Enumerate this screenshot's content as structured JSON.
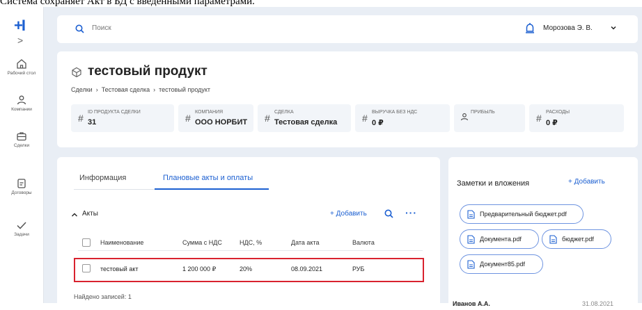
{
  "caption": "Система сохраняет Акт в БД с введенными параметрами.",
  "sidebar": {
    "collapse_glyph": ">",
    "items": [
      {
        "label": "Рабочий стол"
      },
      {
        "label": "Компании"
      },
      {
        "label": "Сделки"
      },
      {
        "label": "Договоры"
      },
      {
        "label": "Задачи"
      }
    ]
  },
  "topbar": {
    "search_placeholder": "Поиск",
    "user_name": "Морозова Э. В."
  },
  "product": {
    "title": "тестовый продукт",
    "breadcrumb": [
      "Сделки",
      "Тестовая сделка",
      "тестовый продукт"
    ]
  },
  "stats": [
    {
      "label": "ID ПРОДУКТА СДЕЛКИ",
      "value": "31"
    },
    {
      "label": "КОМПАНИЯ",
      "value": "ООО НОРБИТ"
    },
    {
      "label": "СДЕЛКА",
      "value": "Тестовая сделка"
    },
    {
      "label": "ВЫРУЧКА БЕЗ НДС",
      "value": "0 ₽"
    },
    {
      "label": "ПРИБЫЛЬ",
      "value": ""
    },
    {
      "label": "РАСХОДЫ",
      "value": "0 ₽"
    }
  ],
  "tabs": {
    "info": "Информация",
    "plan": "Плановые акты и оплаты"
  },
  "acts": {
    "title": "Акты",
    "add_label": "+ Добавить",
    "more_label": "···",
    "columns": [
      "Наименование",
      "Сумма с НДС",
      "НДС, %",
      "Дата акта",
      "Валюта"
    ],
    "rows": [
      [
        "тестовый акт",
        "1 200 000 ₽",
        "20%",
        "08.09.2021",
        "РУБ"
      ]
    ],
    "records": "Найдено записей: 1"
  },
  "notes": {
    "title": "Заметки и вложения",
    "add_label": "+ Добавить",
    "files": [
      "Предварительный бюджет.pdf",
      "Документа.pdf",
      "бюджет.pdf",
      "Документ85.pdf"
    ],
    "author": "Иванов А.А.",
    "date": "31.08.2021"
  },
  "colors": {
    "accent": "#1b5fd1",
    "highlight": "#d8222e",
    "background": "#e9eef5"
  }
}
